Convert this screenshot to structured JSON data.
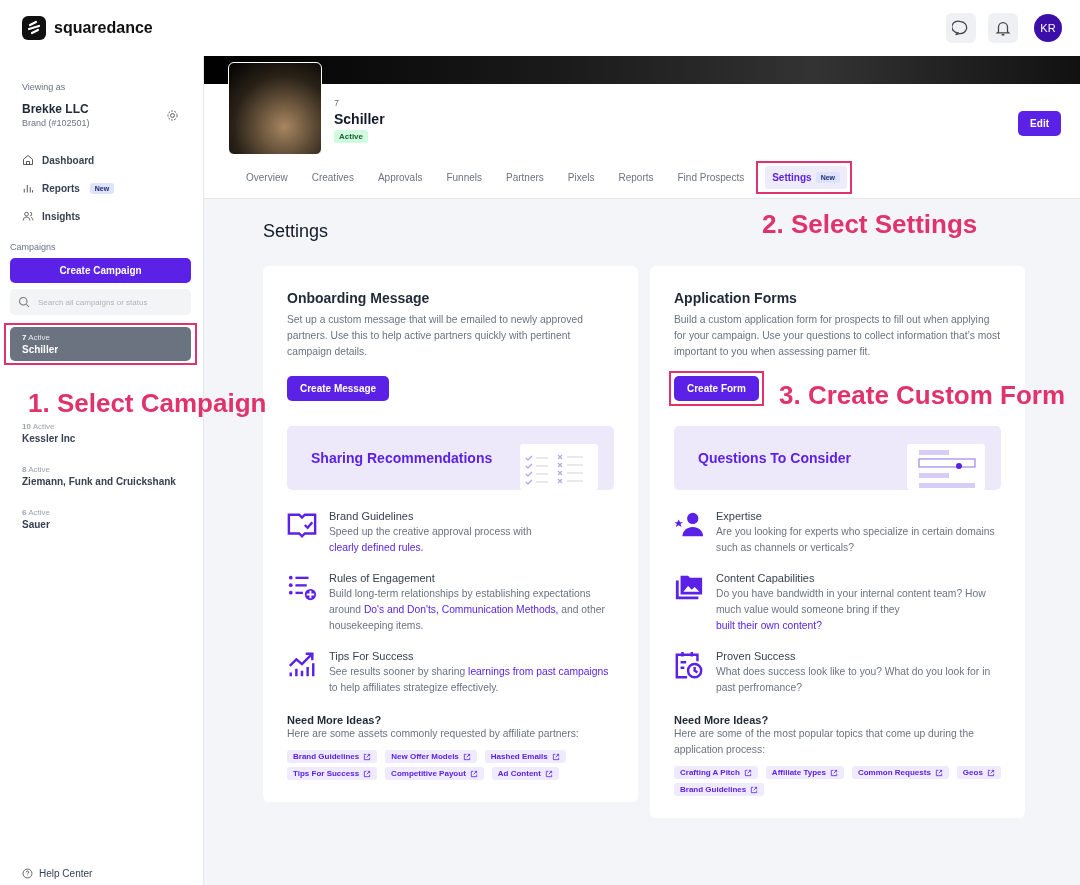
{
  "header": {
    "brand": "squaredance",
    "avatar": "KR"
  },
  "sidebar": {
    "viewing_label": "Viewing as",
    "account_name": "Brekke LLC",
    "account_type": "Brand (#102501)",
    "nav": [
      {
        "label": "Dashboard"
      },
      {
        "label": "Reports",
        "badge": "New"
      },
      {
        "label": "Insights"
      }
    ],
    "campaigns_label": "Campaigns",
    "create_button": "Create Campaign",
    "search": {
      "placeholder": "Search all campaigns or status"
    },
    "campaigns": [
      {
        "count": "7",
        "status": "Active",
        "name": "Schiller",
        "selected": true,
        "highlighted": true
      },
      {
        "count": "10",
        "status": "Active",
        "name": "Kessler Inc",
        "selected": false,
        "highlighted": false
      },
      {
        "count": "8",
        "status": "Active",
        "name": "Ziemann, Funk and Cruickshank",
        "selected": false,
        "highlighted": false
      },
      {
        "count": "6",
        "status": "Active",
        "name": "Sauer",
        "selected": false,
        "highlighted": false
      }
    ],
    "help": "Help Center"
  },
  "campaign": {
    "number": "7",
    "name": "Schiller",
    "status": "Active",
    "edit_button": "Edit",
    "tabs": [
      {
        "label": "Overview",
        "selected": false,
        "highlighted": false
      },
      {
        "label": "Creatives",
        "selected": false,
        "highlighted": false
      },
      {
        "label": "Approvals",
        "selected": false,
        "highlighted": false
      },
      {
        "label": "Funnels",
        "selected": false,
        "highlighted": false
      },
      {
        "label": "Partners",
        "selected": false,
        "highlighted": false
      },
      {
        "label": "Pixels",
        "selected": false,
        "highlighted": false
      },
      {
        "label": "Reports",
        "selected": false,
        "highlighted": false
      },
      {
        "label": "Find Prospects",
        "selected": false,
        "highlighted": false
      },
      {
        "label": "Settings",
        "badge": "New",
        "selected": true,
        "highlighted": true
      }
    ]
  },
  "settings": {
    "title": "Settings",
    "cards": [
      {
        "title": "Onboarding Message",
        "description": "Set up a custom message that will be emailed to newly approved partners. Use this to help active partners quickly with pertinent campaign details.",
        "button": "Create Message",
        "button_highlighted": false,
        "promo": {
          "title": "Sharing Recommendations",
          "kind": "checklist"
        },
        "features": [
          {
            "title": "Brand Guidelines",
            "description": [
              {
                "text": "Speed up the creative approval process with ",
                "link": false
              },
              {
                "text": "clearly defined rules.",
                "link": true
              }
            ]
          },
          {
            "title": "Rules of Engagement",
            "description": [
              {
                "text": "Build long-term relationships by establishing expectations around ",
                "link": false
              },
              {
                "text": "Do's and Don'ts, Communication Methods,",
                "link": true
              },
              {
                "text": " and other housekeeping items.",
                "link": false
              }
            ]
          },
          {
            "title": "Tips For Success",
            "description": [
              {
                "text": "See results sooner by sharing ",
                "link": false
              },
              {
                "text": "learnings from past campaigns",
                "link": true
              },
              {
                "text": " to help affiliates strategize effectively.",
                "link": false
              }
            ]
          }
        ],
        "ideas_title": "Need More Ideas?",
        "ideas_text": "Here are some assets commonly requested by affiliate partners:",
        "tags": [
          "Brand Guidelines",
          "New Offer Models",
          "Hashed Emails",
          "Tips For Success",
          "Competitive Payout",
          "Ad Content"
        ]
      },
      {
        "title": "Application Forms",
        "description": "Build a custom application form for prospects to fill out when applying for your campaign. Use your questions to collect information that’s most important to you when assessing parner fit.",
        "button": "Create Form",
        "button_highlighted": true,
        "promo": {
          "title": "Questions To Consider",
          "kind": "form"
        },
        "features": [
          {
            "title": "Expertise",
            "description": [
              {
                "text": "Are you looking for experts who specialize in certain domains such as channels or verticals?",
                "link": false
              }
            ]
          },
          {
            "title": "Content Capabilities",
            "description": [
              {
                "text": "Do you have bandwidth in your internal content team? How much value would someone bring if they ",
                "link": false
              },
              {
                "text": "built their own content?",
                "link": true
              }
            ]
          },
          {
            "title": "Proven Success",
            "description": [
              {
                "text": "What does success look like to you? What do you look for in past perfromance?",
                "link": false
              }
            ]
          }
        ],
        "ideas_title": "Need More Ideas?",
        "ideas_text": "Here are some of the most popular topics that come up during the application process:",
        "tags": [
          "Crafting A Pitch",
          "Affiliate Types",
          "Common Requests",
          "Geos",
          "Brand Guidelines"
        ]
      }
    ]
  },
  "annotations": [
    "1. Select Campaign",
    "2. Select Settings",
    "3. Create Custom Form"
  ]
}
